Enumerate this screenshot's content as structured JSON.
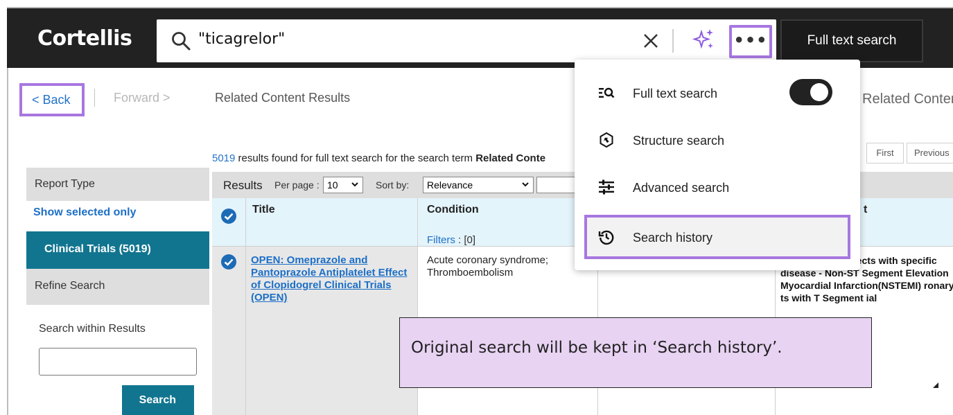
{
  "header": {
    "logo": "Cortellis",
    "search_value": "\"ticagrelor\"",
    "full_text_button": "Full text search",
    "more_label": "•••"
  },
  "nav": {
    "back": "< Back",
    "forward": "Forward >",
    "title": "Related Content Results",
    "title_right": "Related Conter"
  },
  "results": {
    "count": "5019",
    "found_text": " results found for full text search for the search term ",
    "term": "Related Conte",
    "pager_first": "First",
    "pager_previous": "Previous",
    "label": "Results",
    "per_page_label": "Per page :",
    "per_page_value": "10",
    "sort_by_label": "Sort by:",
    "sort_value": "Relevance"
  },
  "sidebar": {
    "report_type": "Report Type",
    "show_selected": "Show selected only",
    "clinical_trials": "Clinical Trials (5019)",
    "refine_search": "Refine Search",
    "search_within": "Search within Results",
    "search_button": "Search"
  },
  "table": {
    "headers": {
      "title": "Title",
      "condition": "Condition",
      "filters": "Filters",
      "filters_count": " : [0]",
      "last_col": "t"
    },
    "rows": [
      {
        "title": "OPEN: Omeprazole and Pantoprazole Antiplatelet Effect of Clopidogrel Clinical Trials (OPEN)",
        "condition": "Acute coronary syndrome; Thromboembolism",
        "right_text": "syndrome - Subjects with specific disease - Non-ST Segment Elevation Myocardial Infarction(NSTEMI) ronary ts with T Segment ial"
      }
    ]
  },
  "dropdown": {
    "items": [
      {
        "label": "Full text search",
        "icon": "full-text-search-icon",
        "toggle_on": true
      },
      {
        "label": "Structure search",
        "icon": "structure-search-icon"
      },
      {
        "label": "Advanced search",
        "icon": "advanced-search-icon"
      },
      {
        "label": "Search history",
        "icon": "history-icon"
      }
    ]
  },
  "callout": {
    "text": "Original search will be kept in ‘Search history’."
  },
  "colors": {
    "header_bg": "#222222",
    "highlight": "#a777e0",
    "teal": "#12758f",
    "link": "#1c6fc7",
    "callout_bg": "#e8d3f3"
  }
}
